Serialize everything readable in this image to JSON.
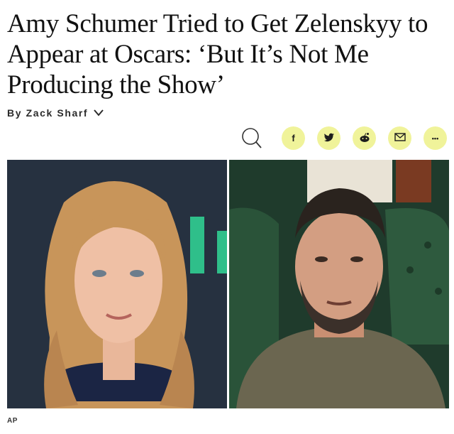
{
  "article": {
    "headline": "Amy Schumer Tried to Get Zelenskyy to Appear at Oscars: ‘But It’s Not Me Producing the Show’",
    "byline": "By Zack Sharf",
    "photo_credit": "AP"
  },
  "share_bar": {
    "buttons": [
      {
        "icon": "facebook-icon",
        "glyph": "f"
      },
      {
        "icon": "twitter-icon",
        "glyph": ""
      },
      {
        "icon": "reddit-icon",
        "glyph": ""
      },
      {
        "icon": "email-icon",
        "glyph": ""
      },
      {
        "icon": "more-icon",
        "glyph": "•••"
      }
    ],
    "accent_color": "#f0f39a"
  }
}
